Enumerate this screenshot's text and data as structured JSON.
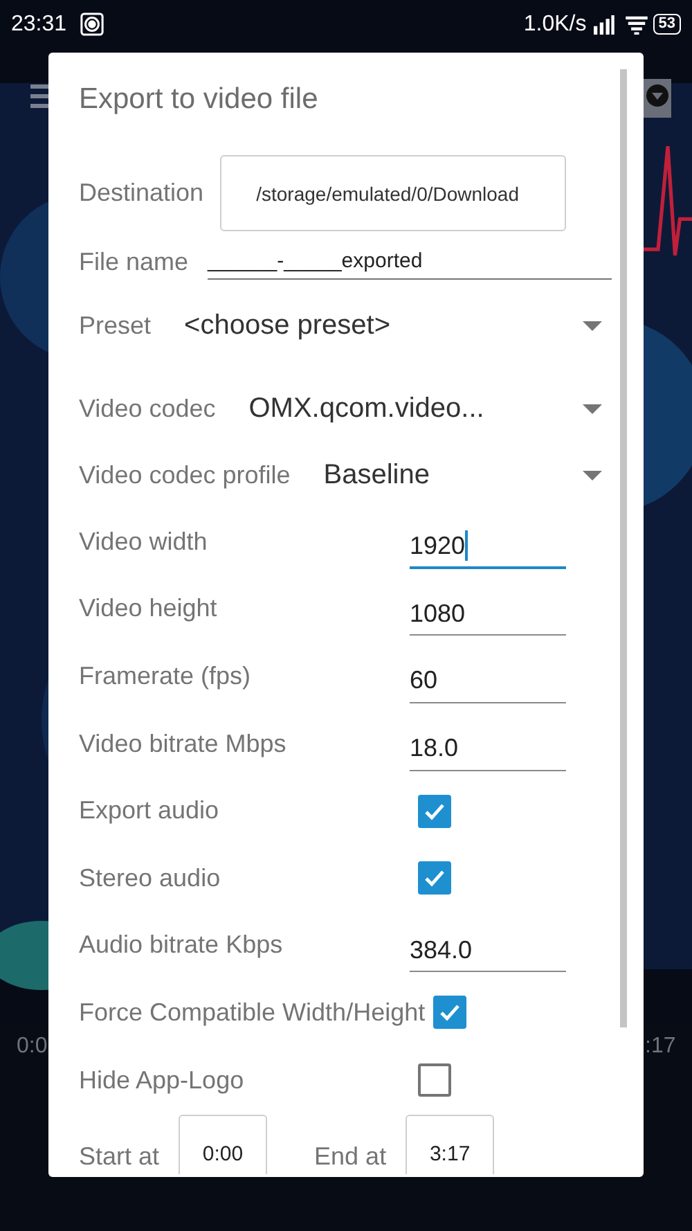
{
  "status_bar": {
    "time": "23:31",
    "net_speed": "1.0K/s",
    "battery": "53"
  },
  "background": {
    "elapsed": "0:0",
    "duration": ":17"
  },
  "dialog": {
    "title": "Export to video file",
    "destination": {
      "label": "Destination",
      "value": "/storage/emulated/0/Download"
    },
    "file_name": {
      "label": "File name",
      "value": "______-_____exported"
    },
    "dropdowns": [
      {
        "label": "Preset",
        "value": "<choose preset>"
      },
      {
        "label": "Video codec",
        "value": "OMX.qcom.video..."
      },
      {
        "label": "Video codec profile",
        "value": "Baseline"
      }
    ],
    "rows": [
      {
        "kind": "input",
        "label": "Video width",
        "value": "1920",
        "focused": true
      },
      {
        "kind": "input",
        "label": "Video height",
        "value": "1080",
        "focused": false
      },
      {
        "kind": "input",
        "label": "Framerate (fps)",
        "value": "60",
        "focused": false
      },
      {
        "kind": "input",
        "label": "Video bitrate Mbps",
        "value": "18.0",
        "focused": false
      },
      {
        "kind": "checkbox",
        "label": "Export audio",
        "checked": true
      },
      {
        "kind": "checkbox",
        "label": "Stereo audio",
        "checked": true
      },
      {
        "kind": "input",
        "label": "Audio bitrate Kbps",
        "value": "384.0",
        "focused": false
      },
      {
        "kind": "checkbox",
        "label": "Force Compatible Width/Height",
        "checked": true
      },
      {
        "kind": "checkbox",
        "label": "Hide App-Logo",
        "checked": false
      }
    ],
    "range": {
      "start_label": "Start at",
      "start": "0:00",
      "end_label": "End at",
      "end": "3:17"
    }
  }
}
